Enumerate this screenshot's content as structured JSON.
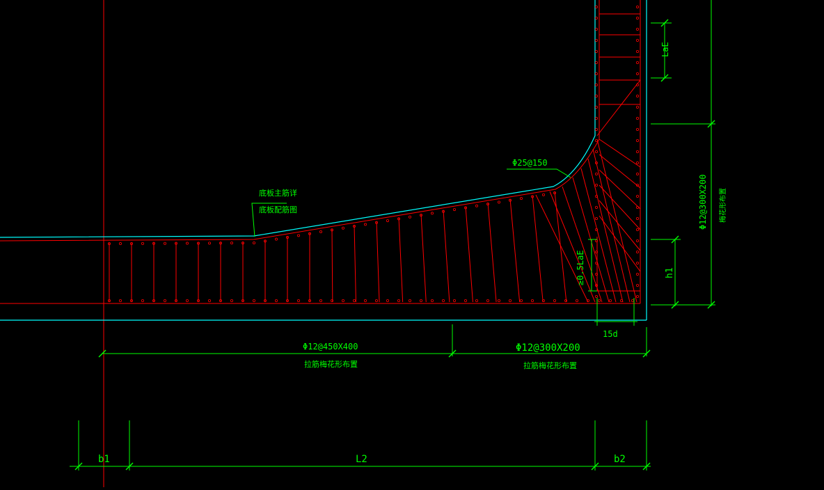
{
  "drawing": {
    "colors": {
      "background": "#000000",
      "concrete_outline": "#00FFFF",
      "rebar": "#FF0000",
      "annotation": "#00FF00",
      "leader": "#FFFFFF",
      "dim_line": "#00FF00"
    },
    "labels": {
      "slab_main_rebar_1": "底板主筋详",
      "slab_main_rebar_2": "底板配筋图",
      "haunch_bar": "Φ25@150",
      "wall_anchor": "LaE",
      "half_anchor": "≥0.5LaE",
      "h1": "h1",
      "wall_tie_spec": "Φ12@300X200",
      "wall_tie_note": "梅花形布置",
      "hook_15d": "15d",
      "tie_left_spec": "Φ12@450X400",
      "tie_left_note": "拉筋梅花形布置",
      "tie_right_spec": "Φ12@300X200",
      "tie_right_note": "拉筋梅花形布置",
      "dim_b1": "b1",
      "dim_L2": "L2",
      "dim_b2": "b2"
    }
  }
}
